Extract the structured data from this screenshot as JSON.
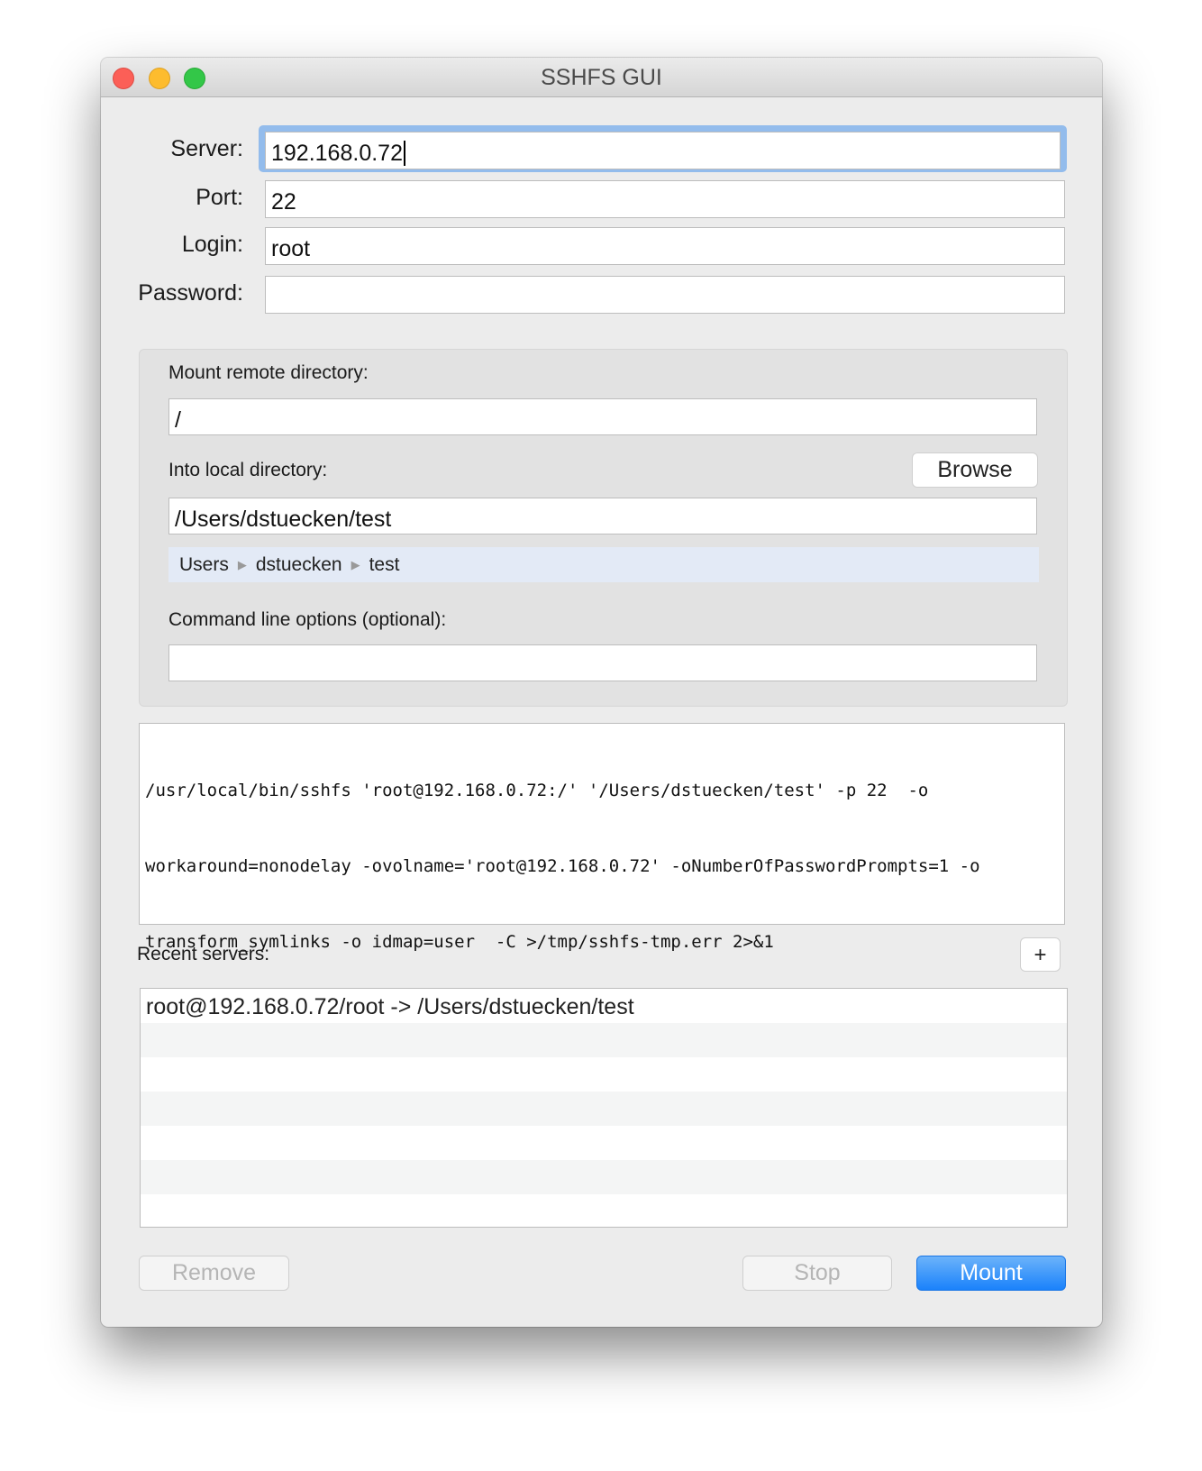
{
  "window": {
    "title": "SSHFS GUI"
  },
  "form": {
    "server_label": "Server:",
    "server_value": "192.168.0.72",
    "port_label": "Port:",
    "port_value": "22",
    "login_label": "Login:",
    "login_value": "root",
    "password_label": "Password:",
    "password_value": ""
  },
  "mount": {
    "remote_label": "Mount remote directory:",
    "remote_value": "/",
    "local_label": "Into local directory:",
    "browse_label": "Browse",
    "local_value": "/Users/dstuecken/test",
    "path": [
      "Users",
      "dstuecken",
      "test"
    ],
    "options_label": "Command line options (optional):",
    "options_value": ""
  },
  "command": {
    "lines": [
      "/usr/local/bin/sshfs 'root@192.168.0.72:/' '/Users/dstuecken/test' -p 22  -o",
      "workaround=nonodelay -ovolname='root@192.168.0.72' -oNumberOfPasswordPrompts=1 -o",
      "transform_symlinks -o idmap=user  -C >/tmp/sshfs-tmp.err 2>&1"
    ]
  },
  "recent": {
    "label": "Recent servers:",
    "add_label": "+",
    "items": [
      "root@192.168.0.72/root -> /Users/dstuecken/test"
    ]
  },
  "buttons": {
    "remove": "Remove",
    "stop": "Stop",
    "mount": "Mount"
  },
  "colors": {
    "accent": "#1a82fb",
    "focus": "#93bcec",
    "path_bg": "#e3eaf6"
  }
}
